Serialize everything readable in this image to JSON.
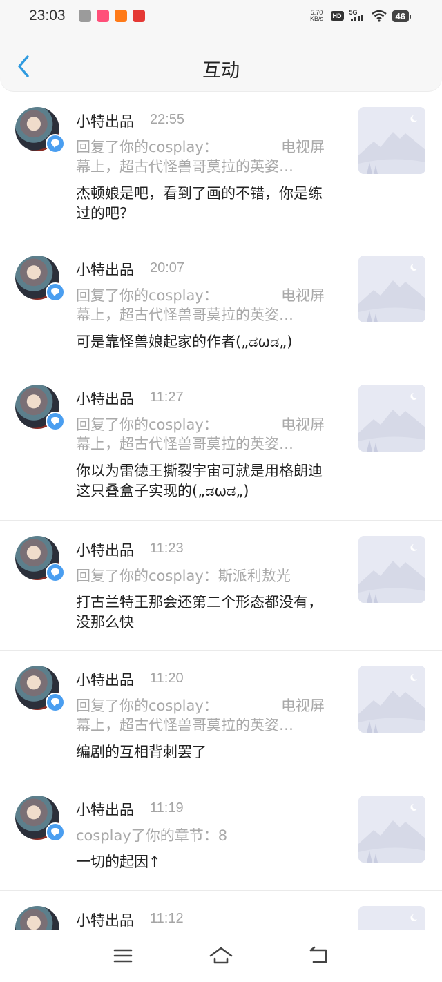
{
  "status_bar": {
    "time": "23:03",
    "net_speed_value": "5.70",
    "net_speed_unit": "KB/s",
    "hd": "HD",
    "network": "5G",
    "battery": "46",
    "app_icon_colors": [
      "#9b9b9b",
      "#ff4f79",
      "#ff7a18",
      "#e53935"
    ]
  },
  "header": {
    "title": "互动",
    "accent_color": "#2f9be0"
  },
  "items": [
    {
      "user": "小特出品",
      "time": "22:55",
      "quote_prefix": "回复了你的cosplay：",
      "quote_tail": "电视屏",
      "quote_line2": "幕上，超古代怪兽哥莫拉的英姿…",
      "comment": "杰顿娘是吧，看到了画的不错，你是练过的吧？"
    },
    {
      "user": "小特出品",
      "time": "20:07",
      "quote_prefix": "回复了你的cosplay：",
      "quote_tail": "电视屏",
      "quote_line2": "幕上，超古代怪兽哥莫拉的英姿…",
      "comment": "可是靠怪兽娘起家的作者(„ಡωಡ„)"
    },
    {
      "user": "小特出品",
      "time": "11:27",
      "quote_prefix": "回复了你的cosplay：",
      "quote_tail": "电视屏",
      "quote_line2": "幕上，超古代怪兽哥莫拉的英姿…",
      "comment": "你以为雷德王撕裂宇宙可就是用格朗迪这只叠盒子实现的(„ಡωಡ„)"
    },
    {
      "user": "小特出品",
      "time": "11:23",
      "quote_prefix": "回复了你的cosplay：斯派利敖光",
      "quote_tail": "",
      "quote_line2": "",
      "comment": "打古兰特王那会还第二个形态都没有，没那么快"
    },
    {
      "user": "小特出品",
      "time": "11:20",
      "quote_prefix": "回复了你的cosplay：",
      "quote_tail": "电视屏",
      "quote_line2": "幕上，超古代怪兽哥莫拉的英姿…",
      "comment": "编剧的互相背刺罢了"
    },
    {
      "user": "小特出品",
      "time": "11:19",
      "quote_prefix": "cosplay了你的章节：8",
      "quote_tail": "",
      "quote_line2": "",
      "comment": "一切的起因↑"
    },
    {
      "user": "小特出品",
      "time": "11:12",
      "quote_prefix": "",
      "quote_tail": "",
      "quote_line2": "",
      "comment": ""
    }
  ],
  "nav": {
    "icons": [
      "menu-icon",
      "home-icon",
      "back-icon"
    ]
  }
}
